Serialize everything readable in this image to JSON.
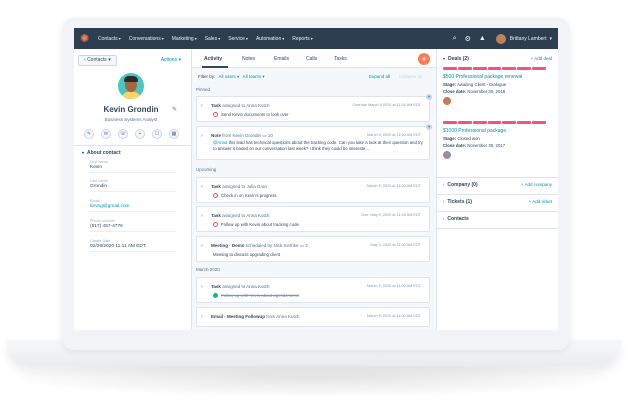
{
  "colors": {
    "nav_bg": "#2d3e50",
    "accent": "#0091ae",
    "brand_orange": "#ff7a59",
    "deal_stripe": "#f2547d",
    "task_done": "#00bda5"
  },
  "nav": {
    "logo_icon": "sprocket-icon",
    "items": [
      {
        "label": "Contacts"
      },
      {
        "label": "Conversations"
      },
      {
        "label": "Marketing"
      },
      {
        "label": "Sales"
      },
      {
        "label": "Service"
      },
      {
        "label": "Automation"
      },
      {
        "label": "Reports"
      }
    ],
    "user_name": "Brittany Lambert"
  },
  "contact": {
    "back_label": "Contacts",
    "actions_label": "Actions",
    "name": "Kevin Grondin",
    "title": "Business Systems Analyst",
    "about_label": "About contact",
    "fields": [
      {
        "label": "First name",
        "value": "Kevin"
      },
      {
        "label": "Last name",
        "value": "Grondin"
      },
      {
        "label": "Email",
        "value": "kevng@gmail.com"
      },
      {
        "label": "Phone number",
        "value": "(617) 457-4776"
      },
      {
        "label": "Create Date",
        "value": "02/28/2020 11:11 AM EDT"
      }
    ]
  },
  "activity": {
    "tabs": [
      "Activity",
      "Notes",
      "Emails",
      "Calls",
      "Tasks"
    ],
    "filter_label": "Filter by:",
    "filter_users": "All users",
    "filter_teams": "All teams",
    "expand_all": "Expand all",
    "collapse_all": "Collapse all",
    "groups": {
      "pinned": "Pinned",
      "upcoming": "Upcoming",
      "march": "March 2020"
    },
    "items": [
      {
        "head_type": "Task",
        "head_rest": "assigned to Anna Kutch",
        "date": "Overdue March 9 2020 at 11:00 AM EDT",
        "body": "Send Kevin documents to look over"
      },
      {
        "head_type": "Note",
        "head_rest": "from Kevin Grondin",
        "comments": "10",
        "date": "March 9, 2020 at 11:00 AM EDT",
        "mention": "@Anna",
        "body": "this lead has technical questions about the tracking code. Can you take a look at their question and try to answer it based on our conversation last week? I think they could be intereste..."
      },
      {
        "head_type": "Task",
        "head_rest": "assigned to Julia Gran",
        "date": "March 9, 2020 at 11:00 AM EDT",
        "body": "Check in on Kevin's progress"
      },
      {
        "head_type": "Task",
        "head_rest": "assigned to Anna Kutch",
        "date": "Due: May 9, 2020 at 11:00 AM EDT",
        "body": "Follow up with Kevin about tracking code"
      },
      {
        "head_type": "Meeting · Demo",
        "head_rest": "scheduled by Nick Kirshke",
        "comments": "2",
        "date": "May 4, 2020 at 11:00 AM EDT",
        "body": "Meeting to discuss upgrading client"
      },
      {
        "head_type": "Task",
        "head_rest": "assigned to Anna Kutch",
        "date": "March 9, 2020 at 11:00 AM EDT",
        "body": "Follow up with Kevin about agenda items"
      },
      {
        "head_type": "Email · Meeting Followup",
        "head_rest": "from Anna Kutch",
        "date": "March 9, 2020 at 11:00 AM EDT"
      }
    ]
  },
  "sidebar_right": {
    "deals_label": "Deals (2)",
    "add_deal": "+ Add deal",
    "deals": [
      {
        "name": "$500 Professional package renewal",
        "stage_label": "Stage:",
        "stage": "Awaiting Client - Dialogue",
        "close_label": "Close date:",
        "close": "November 30, 2018"
      },
      {
        "name": "$1000 Professional package",
        "stage_label": "Stage:",
        "stage": "Closed won",
        "close_label": "Close date:",
        "close": "November 30, 2017"
      }
    ],
    "company_label": "Company (0)",
    "add_company": "+ Add company",
    "tickets_label": "Tickets (1)",
    "add_ticket": "+ Add ticket",
    "contacts_label": "Contacts"
  }
}
